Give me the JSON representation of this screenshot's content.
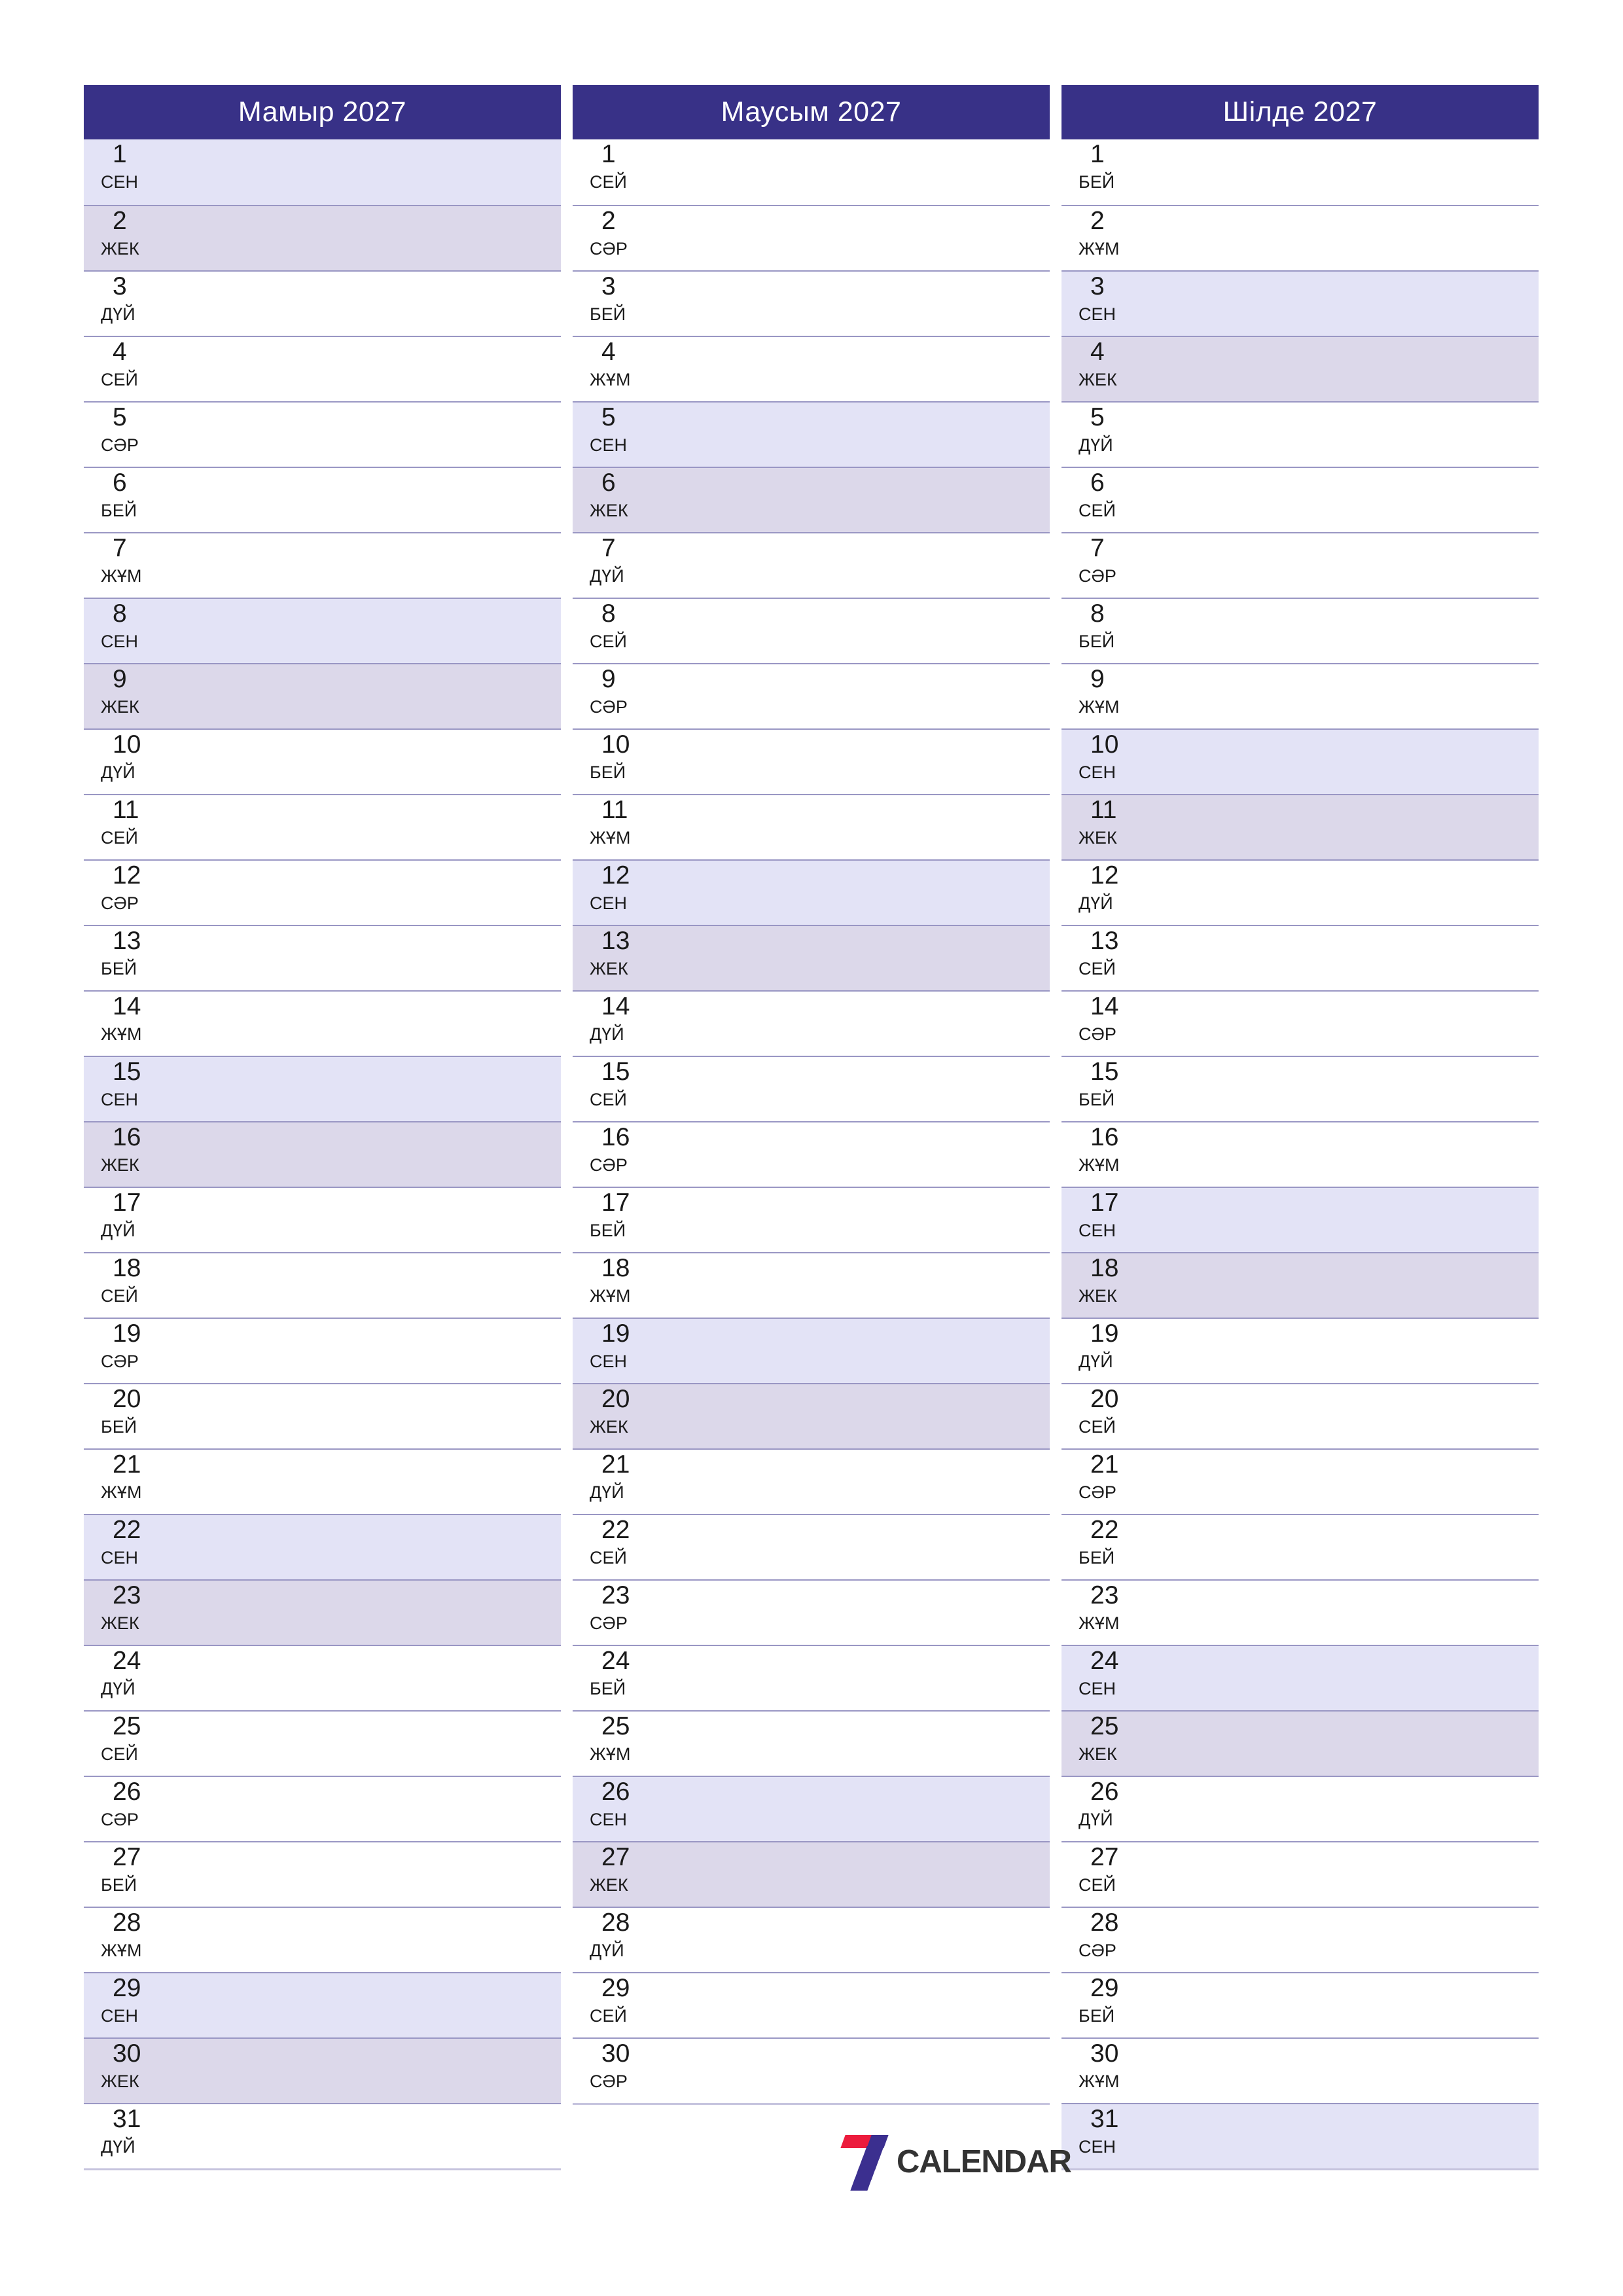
{
  "colors": {
    "header_bg": "#383187",
    "header_text": "#ffffff",
    "saturday_bg": "#e3e3f6",
    "sunday_bg": "#dcd8ea",
    "row_border": "#9a97c4",
    "logo_red": "#ec1c3d",
    "logo_blue": "#3b2f8f",
    "logo_text": "#333333"
  },
  "brand": {
    "name": "CALENDAR",
    "mark": "seven-logo-icon"
  },
  "weekday_labels": {
    "mon": "ДҮЙ",
    "tue": "СЕЙ",
    "wed": "СӘР",
    "thu": "БЕЙ",
    "fri": "ЖҰМ",
    "sat": "СЕН",
    "sun": "ЖЕК"
  },
  "months": [
    {
      "title": "Мамыр 2027",
      "name": "Мамыр",
      "year": "2027",
      "days": [
        {
          "n": "1",
          "dow": "СЕН",
          "type": "sat"
        },
        {
          "n": "2",
          "dow": "ЖЕК",
          "type": "sun"
        },
        {
          "n": "3",
          "dow": "ДҮЙ",
          "type": "weekday"
        },
        {
          "n": "4",
          "dow": "СЕЙ",
          "type": "weekday"
        },
        {
          "n": "5",
          "dow": "СӘР",
          "type": "weekday"
        },
        {
          "n": "6",
          "dow": "БЕЙ",
          "type": "weekday"
        },
        {
          "n": "7",
          "dow": "ЖҰМ",
          "type": "weekday"
        },
        {
          "n": "8",
          "dow": "СЕН",
          "type": "sat"
        },
        {
          "n": "9",
          "dow": "ЖЕК",
          "type": "sun"
        },
        {
          "n": "10",
          "dow": "ДҮЙ",
          "type": "weekday"
        },
        {
          "n": "11",
          "dow": "СЕЙ",
          "type": "weekday"
        },
        {
          "n": "12",
          "dow": "СӘР",
          "type": "weekday"
        },
        {
          "n": "13",
          "dow": "БЕЙ",
          "type": "weekday"
        },
        {
          "n": "14",
          "dow": "ЖҰМ",
          "type": "weekday"
        },
        {
          "n": "15",
          "dow": "СЕН",
          "type": "sat"
        },
        {
          "n": "16",
          "dow": "ЖЕК",
          "type": "sun"
        },
        {
          "n": "17",
          "dow": "ДҮЙ",
          "type": "weekday"
        },
        {
          "n": "18",
          "dow": "СЕЙ",
          "type": "weekday"
        },
        {
          "n": "19",
          "dow": "СӘР",
          "type": "weekday"
        },
        {
          "n": "20",
          "dow": "БЕЙ",
          "type": "weekday"
        },
        {
          "n": "21",
          "dow": "ЖҰМ",
          "type": "weekday"
        },
        {
          "n": "22",
          "dow": "СЕН",
          "type": "sat"
        },
        {
          "n": "23",
          "dow": "ЖЕК",
          "type": "sun"
        },
        {
          "n": "24",
          "dow": "ДҮЙ",
          "type": "weekday"
        },
        {
          "n": "25",
          "dow": "СЕЙ",
          "type": "weekday"
        },
        {
          "n": "26",
          "dow": "СӘР",
          "type": "weekday"
        },
        {
          "n": "27",
          "dow": "БЕЙ",
          "type": "weekday"
        },
        {
          "n": "28",
          "dow": "ЖҰМ",
          "type": "weekday"
        },
        {
          "n": "29",
          "dow": "СЕН",
          "type": "sat"
        },
        {
          "n": "30",
          "dow": "ЖЕК",
          "type": "sun"
        },
        {
          "n": "31",
          "dow": "ДҮЙ",
          "type": "weekday"
        }
      ]
    },
    {
      "title": "Маусым 2027",
      "name": "Маусым",
      "year": "2027",
      "days": [
        {
          "n": "1",
          "dow": "СЕЙ",
          "type": "weekday"
        },
        {
          "n": "2",
          "dow": "СӘР",
          "type": "weekday"
        },
        {
          "n": "3",
          "dow": "БЕЙ",
          "type": "weekday"
        },
        {
          "n": "4",
          "dow": "ЖҰМ",
          "type": "weekday"
        },
        {
          "n": "5",
          "dow": "СЕН",
          "type": "sat"
        },
        {
          "n": "6",
          "dow": "ЖЕК",
          "type": "sun"
        },
        {
          "n": "7",
          "dow": "ДҮЙ",
          "type": "weekday"
        },
        {
          "n": "8",
          "dow": "СЕЙ",
          "type": "weekday"
        },
        {
          "n": "9",
          "dow": "СӘР",
          "type": "weekday"
        },
        {
          "n": "10",
          "dow": "БЕЙ",
          "type": "weekday"
        },
        {
          "n": "11",
          "dow": "ЖҰМ",
          "type": "weekday"
        },
        {
          "n": "12",
          "dow": "СЕН",
          "type": "sat"
        },
        {
          "n": "13",
          "dow": "ЖЕК",
          "type": "sun"
        },
        {
          "n": "14",
          "dow": "ДҮЙ",
          "type": "weekday"
        },
        {
          "n": "15",
          "dow": "СЕЙ",
          "type": "weekday"
        },
        {
          "n": "16",
          "dow": "СӘР",
          "type": "weekday"
        },
        {
          "n": "17",
          "dow": "БЕЙ",
          "type": "weekday"
        },
        {
          "n": "18",
          "dow": "ЖҰМ",
          "type": "weekday"
        },
        {
          "n": "19",
          "dow": "СЕН",
          "type": "sat"
        },
        {
          "n": "20",
          "dow": "ЖЕК",
          "type": "sun"
        },
        {
          "n": "21",
          "dow": "ДҮЙ",
          "type": "weekday"
        },
        {
          "n": "22",
          "dow": "СЕЙ",
          "type": "weekday"
        },
        {
          "n": "23",
          "dow": "СӘР",
          "type": "weekday"
        },
        {
          "n": "24",
          "dow": "БЕЙ",
          "type": "weekday"
        },
        {
          "n": "25",
          "dow": "ЖҰМ",
          "type": "weekday"
        },
        {
          "n": "26",
          "dow": "СЕН",
          "type": "sat"
        },
        {
          "n": "27",
          "dow": "ЖЕК",
          "type": "sun"
        },
        {
          "n": "28",
          "dow": "ДҮЙ",
          "type": "weekday"
        },
        {
          "n": "29",
          "dow": "СЕЙ",
          "type": "weekday"
        },
        {
          "n": "30",
          "dow": "СӘР",
          "type": "weekday"
        }
      ]
    },
    {
      "title": "Шілде 2027",
      "name": "Шілде",
      "year": "2027",
      "days": [
        {
          "n": "1",
          "dow": "БЕЙ",
          "type": "weekday"
        },
        {
          "n": "2",
          "dow": "ЖҰМ",
          "type": "weekday"
        },
        {
          "n": "3",
          "dow": "СЕН",
          "type": "sat"
        },
        {
          "n": "4",
          "dow": "ЖЕК",
          "type": "sun"
        },
        {
          "n": "5",
          "dow": "ДҮЙ",
          "type": "weekday"
        },
        {
          "n": "6",
          "dow": "СЕЙ",
          "type": "weekday"
        },
        {
          "n": "7",
          "dow": "СӘР",
          "type": "weekday"
        },
        {
          "n": "8",
          "dow": "БЕЙ",
          "type": "weekday"
        },
        {
          "n": "9",
          "dow": "ЖҰМ",
          "type": "weekday"
        },
        {
          "n": "10",
          "dow": "СЕН",
          "type": "sat"
        },
        {
          "n": "11",
          "dow": "ЖЕК",
          "type": "sun"
        },
        {
          "n": "12",
          "dow": "ДҮЙ",
          "type": "weekday"
        },
        {
          "n": "13",
          "dow": "СЕЙ",
          "type": "weekday"
        },
        {
          "n": "14",
          "dow": "СӘР",
          "type": "weekday"
        },
        {
          "n": "15",
          "dow": "БЕЙ",
          "type": "weekday"
        },
        {
          "n": "16",
          "dow": "ЖҰМ",
          "type": "weekday"
        },
        {
          "n": "17",
          "dow": "СЕН",
          "type": "sat"
        },
        {
          "n": "18",
          "dow": "ЖЕК",
          "type": "sun"
        },
        {
          "n": "19",
          "dow": "ДҮЙ",
          "type": "weekday"
        },
        {
          "n": "20",
          "dow": "СЕЙ",
          "type": "weekday"
        },
        {
          "n": "21",
          "dow": "СӘР",
          "type": "weekday"
        },
        {
          "n": "22",
          "dow": "БЕЙ",
          "type": "weekday"
        },
        {
          "n": "23",
          "dow": "ЖҰМ",
          "type": "weekday"
        },
        {
          "n": "24",
          "dow": "СЕН",
          "type": "sat"
        },
        {
          "n": "25",
          "dow": "ЖЕК",
          "type": "sun"
        },
        {
          "n": "26",
          "dow": "ДҮЙ",
          "type": "weekday"
        },
        {
          "n": "27",
          "dow": "СЕЙ",
          "type": "weekday"
        },
        {
          "n": "28",
          "dow": "СӘР",
          "type": "weekday"
        },
        {
          "n": "29",
          "dow": "БЕЙ",
          "type": "weekday"
        },
        {
          "n": "30",
          "dow": "ЖҰМ",
          "type": "weekday"
        },
        {
          "n": "31",
          "dow": "СЕН",
          "type": "sat"
        }
      ]
    }
  ]
}
